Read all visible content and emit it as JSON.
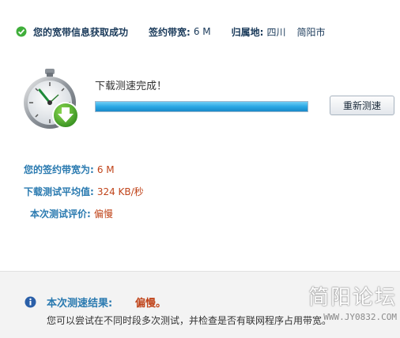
{
  "header": {
    "title": "您的宽带信息获取成功",
    "bandwidth_label": "签约带宽:",
    "bandwidth_value": "6 M",
    "location_label": "归属地:",
    "location_province": "四川",
    "location_city": "简阳市"
  },
  "test": {
    "status": "下载测速完成！",
    "progress_fraction": 1.0,
    "retest_label": "重新测速"
  },
  "stats": {
    "contract_label": "您的签约带宽为:",
    "contract_value": "6 M",
    "avg_label": "下载测试平均值:",
    "avg_value": "324 KB/秒",
    "rating_label": "本次测试评价:",
    "rating_value": "偏慢"
  },
  "result": {
    "label": "本次测速结果:",
    "value": "偏慢。",
    "advice": "您可以尝试在不同时段多次测试，并检查是否有联网程序占用带宽。"
  },
  "watermark": {
    "title": "简阳论坛",
    "url": "WWW.JY0832.COM"
  },
  "colors": {
    "accent_blue": "#2a7ab0",
    "warning_red": "#c0441a",
    "success_green": "#3fae3a",
    "progress_blue": "#2aa8e4"
  }
}
